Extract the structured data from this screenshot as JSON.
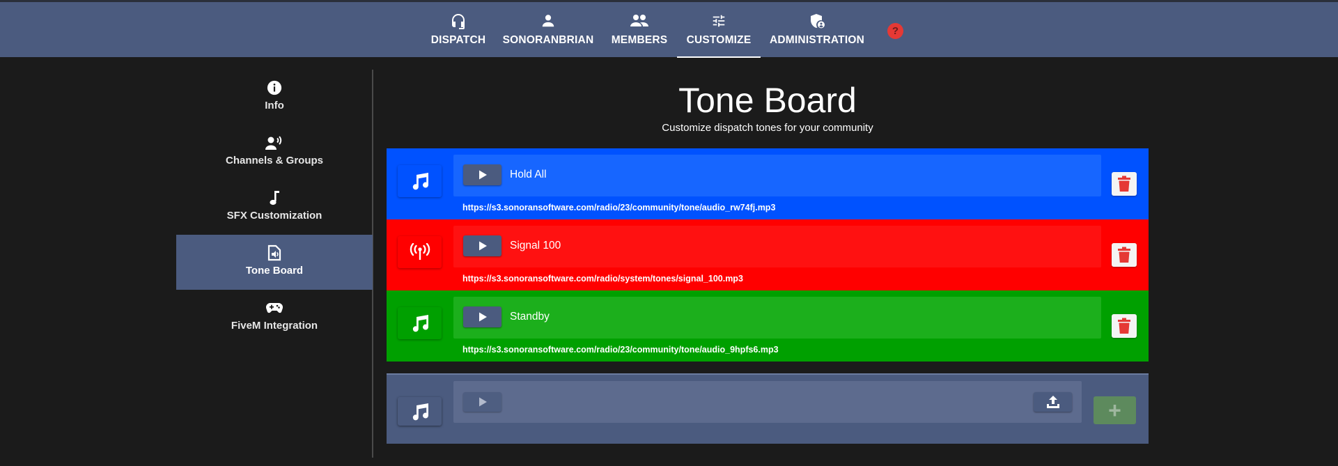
{
  "nav": {
    "items": [
      {
        "label": "DISPATCH",
        "icon": "headset-icon"
      },
      {
        "label": "SONORANBRIAN",
        "icon": "person-icon"
      },
      {
        "label": "MEMBERS",
        "icon": "people-icon"
      },
      {
        "label": "CUSTOMIZE",
        "icon": "sliders-icon",
        "active": true
      },
      {
        "label": "ADMINISTRATION",
        "icon": "admin-shield-icon"
      }
    ],
    "help": "?"
  },
  "sidebar": {
    "items": [
      {
        "label": "Info",
        "icon": "info-icon"
      },
      {
        "label": "Channels & Groups",
        "icon": "record-voice-icon"
      },
      {
        "label": "SFX Customization",
        "icon": "music-note-icon"
      },
      {
        "label": "Tone Board",
        "icon": "audio-file-icon",
        "active": true
      },
      {
        "label": "FiveM Integration",
        "icon": "gamepad-icon"
      }
    ]
  },
  "main": {
    "title": "Tone Board",
    "subtitle": "Customize dispatch tones for your community"
  },
  "tones": [
    {
      "name": "Hold All",
      "url": "https://s3.sonoransoftware.com/radio/23/community/tone/audio_rw74fj.mp3",
      "icon": "music-notes-icon",
      "color": "#0052ff",
      "inner_color": "#1766ff"
    },
    {
      "name": "Signal 100",
      "url": "https://s3.sonoransoftware.com/radio/system/tones/signal_100.mp3",
      "icon": "antenna-icon",
      "color": "#ff0000",
      "inner_color": "#ff1111"
    },
    {
      "name": "Standby",
      "url": "https://s3.sonoransoftware.com/radio/23/community/tone/audio_9hpfs6.mp3",
      "icon": "music-notes-icon",
      "color": "#00a000",
      "inner_color": "#1caf1c"
    }
  ],
  "new_tone": {
    "add_label": "+"
  },
  "colors": {
    "topbar": "#4b5b7f",
    "background": "#1b1b1b",
    "delete_icon": "#e53935"
  }
}
